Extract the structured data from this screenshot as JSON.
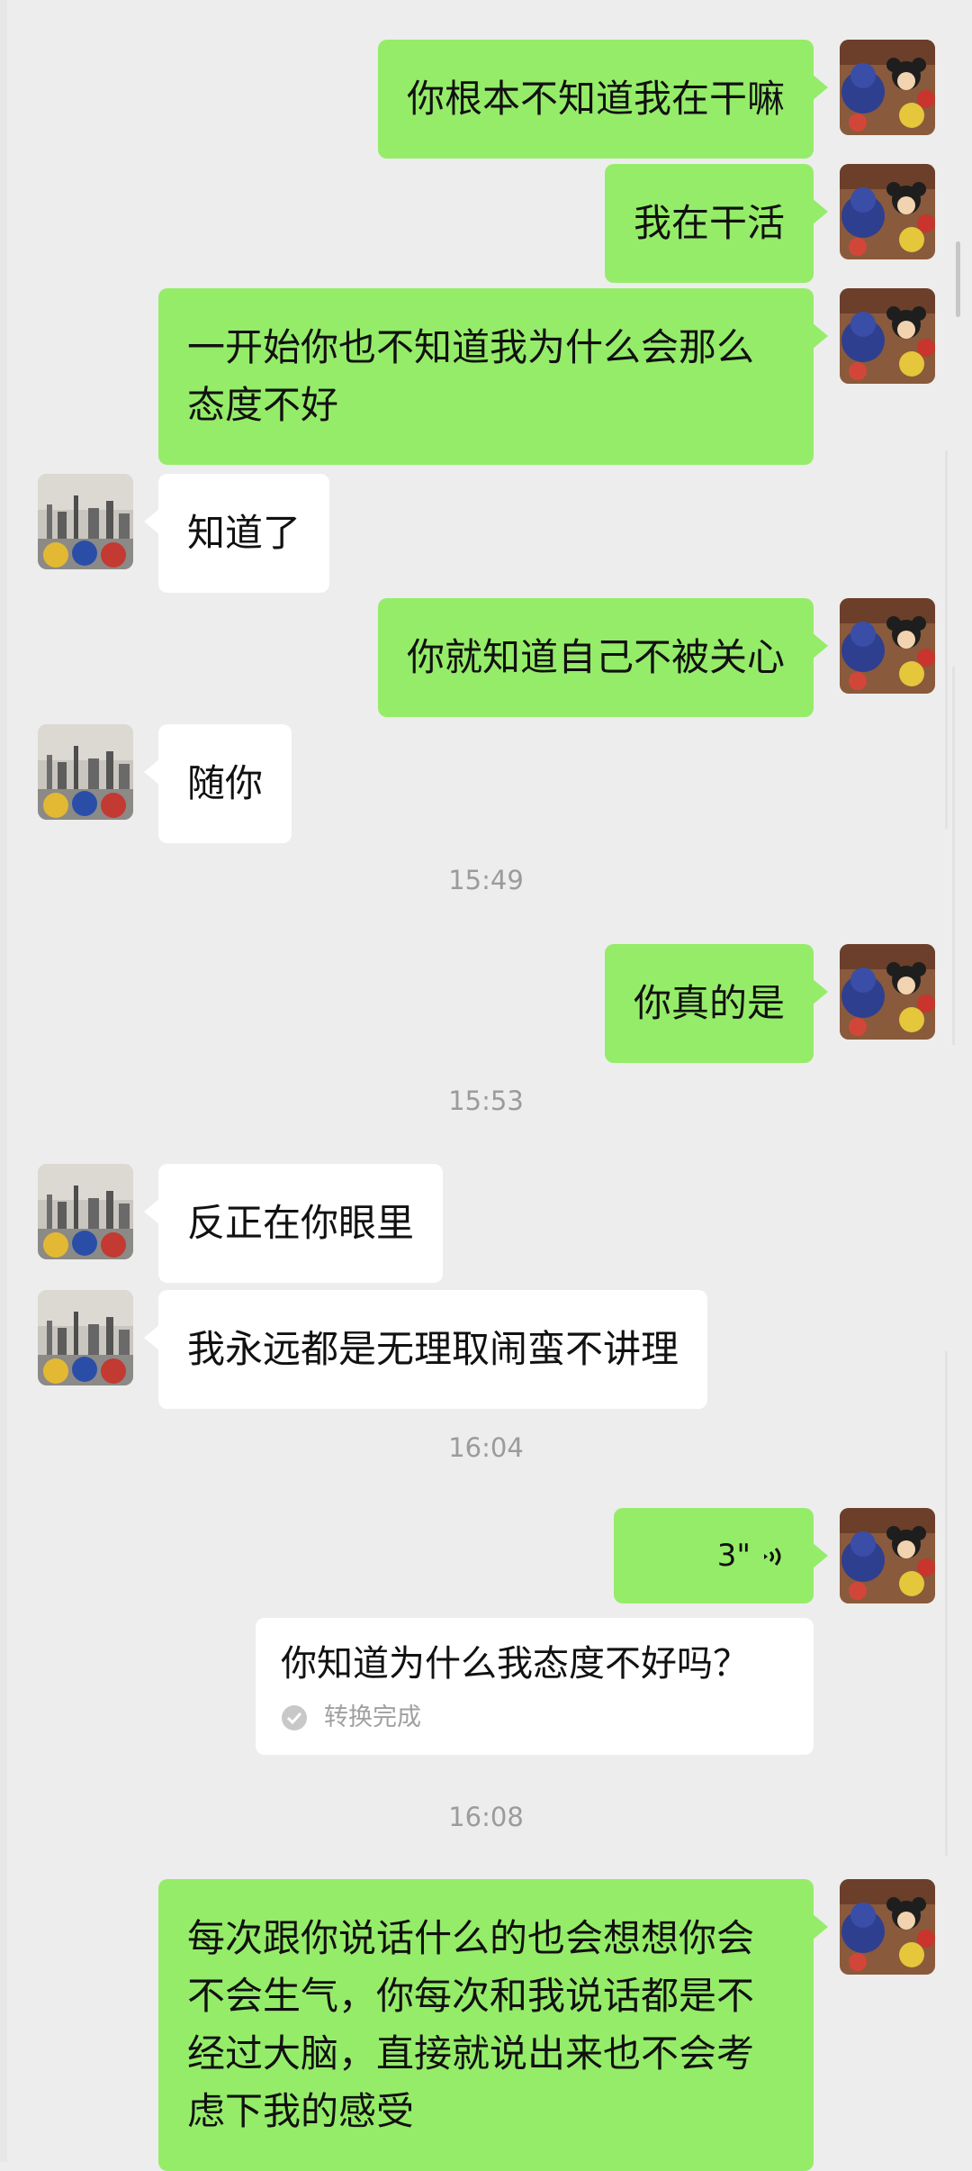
{
  "conversation": {
    "messages": [
      {
        "id": "m1",
        "sender": "self",
        "text": "你根本不知道我在干嘛"
      },
      {
        "id": "m2",
        "sender": "self",
        "text": "我在干活"
      },
      {
        "id": "m3",
        "sender": "self",
        "lines": [
          "一开始你也不知道我为什么会那么",
          "态度不好"
        ]
      },
      {
        "id": "m4",
        "sender": "other",
        "text": "知道了"
      },
      {
        "id": "m5",
        "sender": "self",
        "text": "你就知道自己不被关心"
      },
      {
        "id": "m6",
        "sender": "other",
        "text": "随你"
      },
      {
        "id": "t1",
        "type": "timestamp",
        "text": "15:49"
      },
      {
        "id": "m7",
        "sender": "self",
        "text": "你真的是"
      },
      {
        "id": "t2",
        "type": "timestamp",
        "text": "15:53"
      },
      {
        "id": "m8",
        "sender": "other",
        "text": "反正在你眼里"
      },
      {
        "id": "m9",
        "sender": "other",
        "text": "我永远都是无理取闹蛮不讲理"
      },
      {
        "id": "t3",
        "type": "timestamp",
        "text": "16:04"
      },
      {
        "id": "m10",
        "sender": "self",
        "type": "voice",
        "duration": "3\"",
        "transcript": "你知道为什么我态度不好吗？",
        "transcript_status": "转换完成"
      },
      {
        "id": "t4",
        "type": "timestamp",
        "text": "16:08"
      },
      {
        "id": "m11",
        "sender": "self",
        "lines": [
          "每次跟你说话什么的也会想想你会",
          "不会生气，你每次和我说话都是不",
          "经过大脑，直接就说出来也不会考",
          "虑下我的感受"
        ]
      }
    ]
  },
  "colors": {
    "background": "#ededed",
    "self_bubble": "#95ec69",
    "other_bubble": "#ffffff",
    "timestamp_text": "#9b9b9b"
  },
  "icons": {
    "self_avatar": "plush-toys-avatar",
    "other_avatar": "city-skyline-plush-avatar",
    "voice": "voice-wave-icon",
    "transcript_done": "check-circle-icon"
  }
}
